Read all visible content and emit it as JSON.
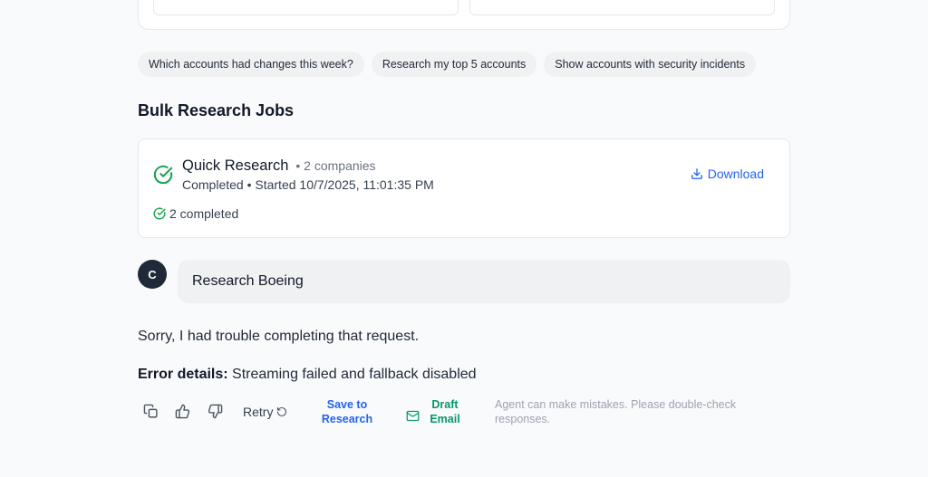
{
  "suggestions": [
    "Which accounts had changes this week?",
    "Research my top 5 accounts",
    "Show accounts with security incidents"
  ],
  "section": {
    "title": "Bulk Research Jobs"
  },
  "job": {
    "title": "Quick Research",
    "count": "• 2 companies",
    "subtitle": "Completed • Started 10/7/2025, 11:01:35 PM",
    "progress": "2 completed",
    "download_label": "Download"
  },
  "user_message": {
    "avatar_initial": "C",
    "text": "Research Boeing"
  },
  "assistant": {
    "text": "Sorry, I had trouble completing that request.",
    "error_label": "Error details:",
    "error_text": " Streaming failed and fallback disabled"
  },
  "actions": {
    "retry_label": "Retry",
    "save_research_label": "Save to Research",
    "draft_email_label": "Draft Email",
    "disclaimer": "Agent can make mistakes. Please double-check responses."
  },
  "colors": {
    "accent": "#2563eb",
    "success": "#16a34a",
    "email": "#059669"
  }
}
